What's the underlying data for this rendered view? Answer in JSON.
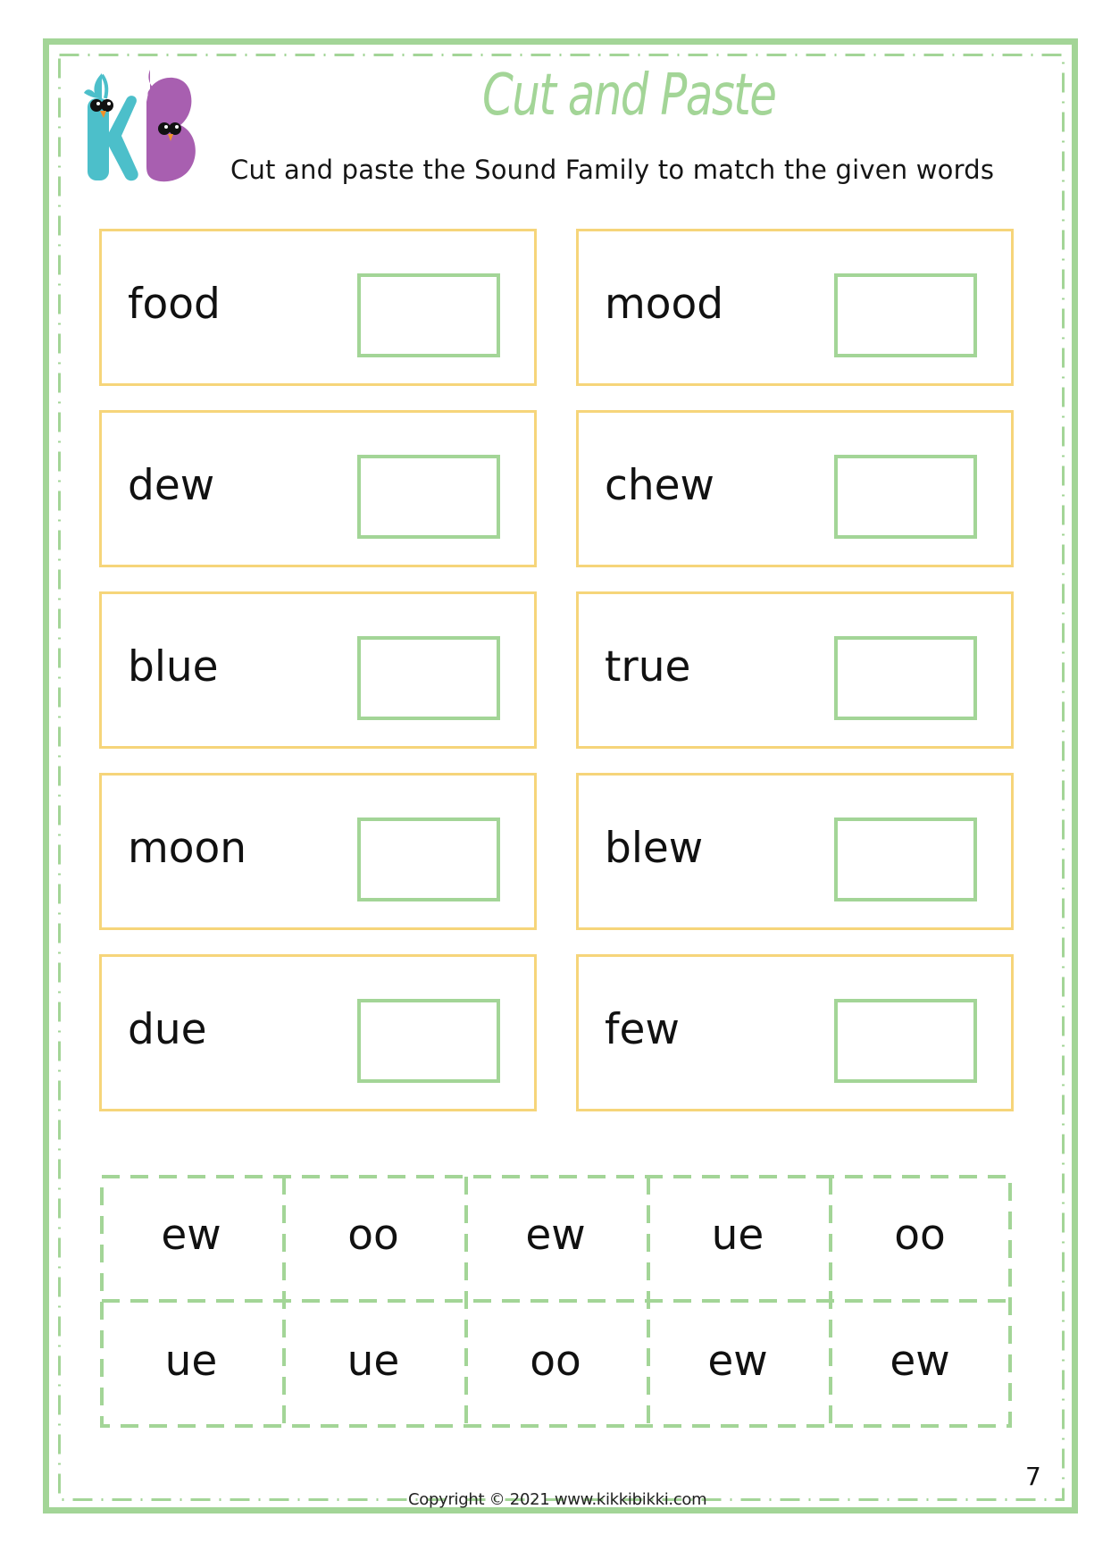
{
  "header": {
    "logo_letters": [
      "K",
      "B"
    ],
    "title": "Cut and Paste",
    "subtitle": "Cut and paste the Sound Family to match the given words"
  },
  "colors": {
    "accent_green": "#a3d597",
    "card_yellow": "#f6d57a",
    "logo_teal": "#4cbfca",
    "logo_purple": "#a85fb0"
  },
  "words": [
    {
      "word": "food"
    },
    {
      "word": "mood"
    },
    {
      "word": "dew"
    },
    {
      "word": "chew"
    },
    {
      "word": "blue"
    },
    {
      "word": "true"
    },
    {
      "word": "moon"
    },
    {
      "word": "blew"
    },
    {
      "word": "due"
    },
    {
      "word": "few"
    }
  ],
  "sound_tiles": {
    "row1": [
      "ew",
      "oo",
      "ew",
      "ue",
      "oo"
    ],
    "row2": [
      "ue",
      "ue",
      "oo",
      "ew",
      "ew"
    ]
  },
  "footer": {
    "copyright": "Copyright © 2021 www.kikkibikki.com",
    "page_number": "7"
  }
}
